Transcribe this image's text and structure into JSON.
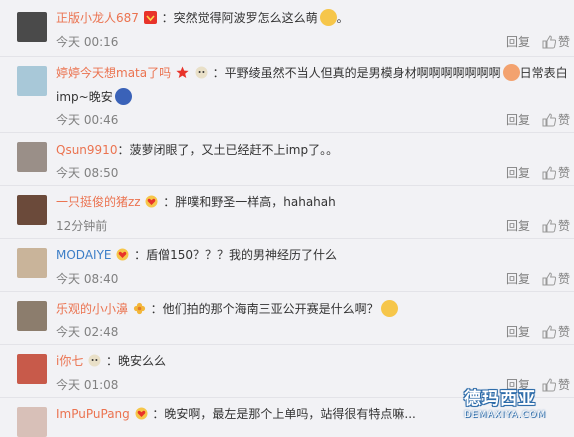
{
  "comments": [
    {
      "user": "正版小龙人687",
      "text": "：突然觉得阿波罗怎么这么萌",
      "tail": "。",
      "time": "今天 00:16",
      "reply": "回复",
      "like": "赞",
      "avatar_color": "#4a4a4a"
    },
    {
      "user": "婷婷今天想mata了吗",
      "text": "：平野绫虽然不当人但真的是男模身材啊啊啊啊啊啊啊",
      "text_after_emoji": "日常表白",
      "line2": "imp~晚安",
      "time": "今天 00:46",
      "reply": "回复",
      "like": "赞",
      "avatar_color": "#a8c8d8"
    },
    {
      "user": "Qsun9910",
      "text": "：菠萝闭眼了，又土已经赶不上imp了。。",
      "time": "今天 08:50",
      "reply": "回复",
      "like": "赞",
      "avatar_color": "#9a8f88"
    },
    {
      "user": "一只挺俊的猪zz",
      "text": "：胖噗和野圣一样高，hahahah",
      "time": "12分钟前",
      "reply": "回复",
      "like": "赞",
      "avatar_color": "#6b4a3a"
    },
    {
      "user": "MODAIYE",
      "text": "：盾僧150？？？我的男神经历了什么",
      "time": "今天 08:40",
      "reply": "回复",
      "like": "赞",
      "avatar_color": "#c9b49a"
    },
    {
      "user": "乐观的小小濞",
      "text": "：他们拍的那个海南三亚公开赛是什么啊？",
      "time": "今天 02:48",
      "reply": "回复",
      "like": "赞",
      "avatar_color": "#8c7d6d"
    },
    {
      "user": "i你七",
      "text": "：晚安么么",
      "time": "今天 01:08",
      "reply": "回复",
      "like": "赞",
      "avatar_color": "#c85a4a"
    },
    {
      "user": "ImPuPuPang",
      "text": "：晚安啊，最左是那个上单吗，站得很有特点嘛...",
      "time": "",
      "reply": "",
      "like": "",
      "avatar_color": "#d8c0b8"
    }
  ],
  "watermark": {
    "title": "德玛西亚",
    "subtitle": "DEMAXIYA.COM"
  },
  "colors": {
    "username": "#eb7350",
    "username_blue": "#3c7ec7",
    "meta": "#808080",
    "background": "#f2f2f5"
  }
}
